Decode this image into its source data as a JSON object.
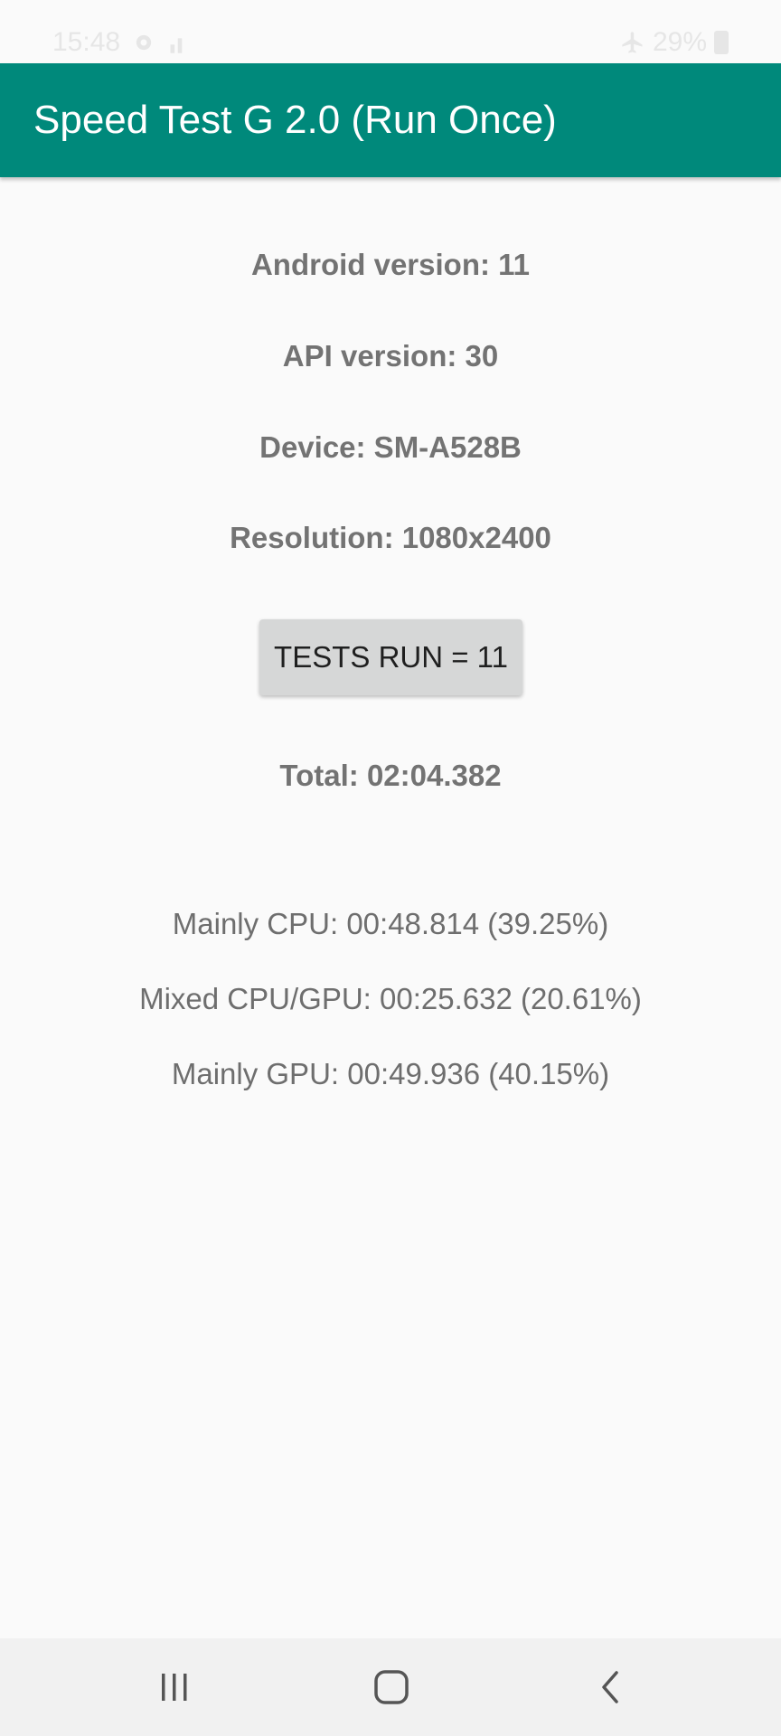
{
  "status_bar": {
    "time": "15:48",
    "battery": "29%",
    "icons": [
      "settings-icon",
      "signal-icon",
      "airplane-icon",
      "battery-icon"
    ]
  },
  "app_bar": {
    "title": "Speed Test G 2.0 (Run Once)",
    "color": "#00897b"
  },
  "device_info": {
    "android_version": "Android version: 11",
    "api_version": "API version: 30",
    "device": "Device: SM-A528B",
    "resolution": "Resolution: 1080x2400"
  },
  "tests_button": {
    "label": "TESTS RUN = 11"
  },
  "total": "Total: 02:04.382",
  "breakdown": {
    "cpu": "Mainly CPU: 00:48.814 (39.25%)",
    "mixed": "Mixed CPU/GPU: 00:25.632 (20.61%)",
    "gpu": "Mainly GPU: 00:49.936 (40.15%)"
  },
  "nav_bar": {
    "icons": [
      "recents-icon",
      "home-icon",
      "back-icon"
    ]
  }
}
